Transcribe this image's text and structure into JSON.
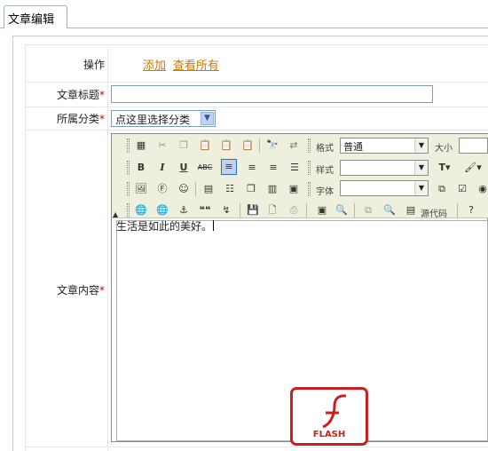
{
  "tab": {
    "label": "文章编辑"
  },
  "form": {
    "actions_label": "操作",
    "add_link": "添加",
    "view_all_link": "查看所有",
    "title_label": "文章标题",
    "title_value": "",
    "category_label": "所属分类",
    "category_value": "点这里选择分类",
    "content_label": "文章内容",
    "required_mark": "*"
  },
  "editor": {
    "format_label": "格式",
    "format_value": "普通",
    "size_label": "大小",
    "size_value": "",
    "style_label": "样式",
    "style_value": "",
    "font_label": "字体",
    "font_value": "",
    "source_label": "源代码",
    "content_text": "生活是如此的美好。",
    "flash_label": "FLASH"
  }
}
